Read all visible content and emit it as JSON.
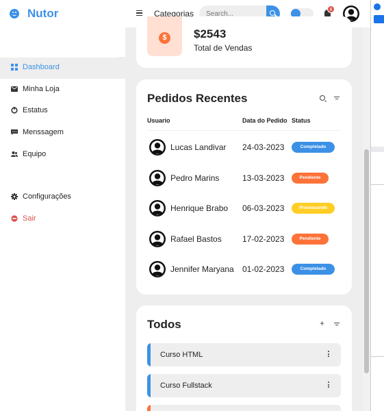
{
  "brand": {
    "name": "Nutor"
  },
  "topbar": {
    "nav_link": "Categorias",
    "search_placeholder": "Search...",
    "notification_count": "8"
  },
  "sidebar": {
    "items": [
      {
        "label": "Dashboard",
        "icon": "dashboard-icon",
        "active": true
      },
      {
        "label": "Minha Loja",
        "icon": "store-icon"
      },
      {
        "label": "Estatus",
        "icon": "stats-icon"
      },
      {
        "label": "Menssagem",
        "icon": "message-icon"
      },
      {
        "label": "Equipo",
        "icon": "team-icon"
      }
    ],
    "bottom": [
      {
        "label": "Configurações",
        "icon": "gear-icon"
      },
      {
        "label": "Sair",
        "icon": "logout-icon"
      }
    ]
  },
  "sales": {
    "value": "$2543",
    "label": "Total de Vendas",
    "icon_glyph": "$"
  },
  "orders": {
    "title": "Pedidos Recentes",
    "columns": [
      "Usuario",
      "Data do Pedido",
      "Status"
    ],
    "rows": [
      {
        "name": "Lucas Landivar",
        "date": "24-03-2023",
        "status": "Completado",
        "color": "#3c91e6"
      },
      {
        "name": "Pedro Marins",
        "date": "13-03-2023",
        "status": "Pendiente",
        "color": "#fd7238"
      },
      {
        "name": "Henrique Brabo",
        "date": "06-03-2023",
        "status": "Processando",
        "color": "#ffce26"
      },
      {
        "name": "Rafael Bastos",
        "date": "17-02-2023",
        "status": "Pendiente",
        "color": "#fd7238"
      },
      {
        "name": "Jennifer Maryana",
        "date": "01-02-2023",
        "status": "Completado",
        "color": "#3c91e6"
      }
    ]
  },
  "todos": {
    "title": "Todos",
    "plus": "+",
    "items": [
      {
        "label": "Curso HTML",
        "color": "#3c91e6"
      },
      {
        "label": "Curso Fullstack",
        "color": "#3c91e6"
      },
      {
        "label": "",
        "color": "#fd7238"
      }
    ]
  },
  "colors": {
    "primary": "#3c91e6",
    "danger": "#db504a",
    "orange": "#fd7238",
    "yellow": "#ffce26",
    "grey": "#eeeeee"
  }
}
